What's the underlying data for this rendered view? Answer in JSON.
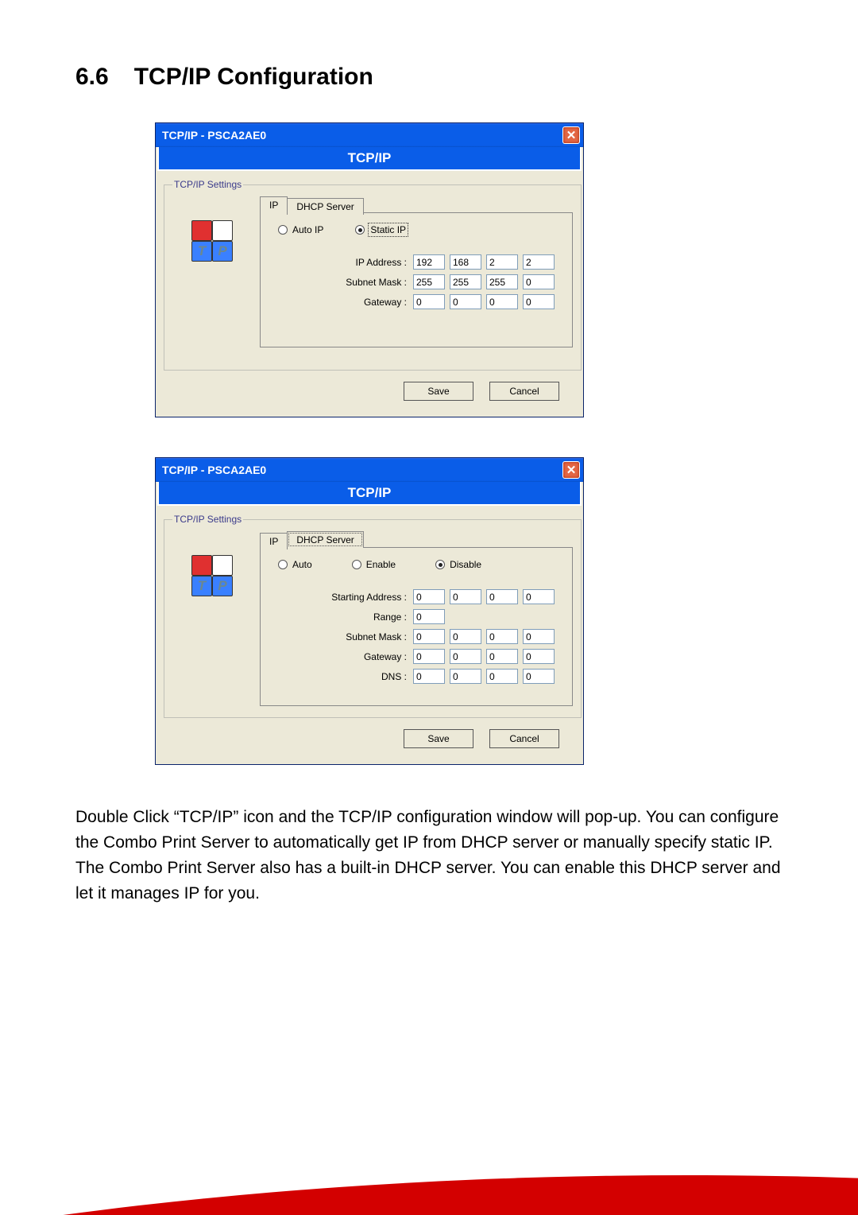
{
  "heading": {
    "number": "6.6",
    "title": "TCP/IP Configuration"
  },
  "dialog1": {
    "titlebar": "TCP/IP - PSCA2AE0",
    "banner": "TCP/IP",
    "groupLegend": "TCP/IP Settings",
    "tabs": {
      "ip": "IP",
      "dhcp": "DHCP Server",
      "active": "ip"
    },
    "radios": {
      "auto": "Auto IP",
      "static": "Static IP",
      "selected": "static"
    },
    "fields": {
      "ip_label": "IP Address :",
      "ip": [
        "192",
        "168",
        "2",
        "2"
      ],
      "mask_label": "Subnet Mask :",
      "mask": [
        "255",
        "255",
        "255",
        "0"
      ],
      "gw_label": "Gateway :",
      "gw": [
        "0",
        "0",
        "0",
        "0"
      ]
    },
    "buttons": {
      "save": "Save",
      "cancel": "Cancel"
    }
  },
  "dialog2": {
    "titlebar": "TCP/IP - PSCA2AE0",
    "banner": "TCP/IP",
    "groupLegend": "TCP/IP Settings",
    "tabs": {
      "ip": "IP",
      "dhcp": "DHCP Server",
      "active": "dhcp"
    },
    "radios": {
      "auto": "Auto",
      "enable": "Enable",
      "disable": "Disable",
      "selected": "disable"
    },
    "fields": {
      "start_label": "Starting Address :",
      "start": [
        "0",
        "0",
        "0",
        "0"
      ],
      "range_label": "Range :",
      "range": [
        "0"
      ],
      "mask_label": "Subnet Mask :",
      "mask": [
        "0",
        "0",
        "0",
        "0"
      ],
      "gw_label": "Gateway :",
      "gw": [
        "0",
        "0",
        "0",
        "0"
      ],
      "dns_label": "DNS :",
      "dns": [
        "0",
        "0",
        "0",
        "0"
      ]
    },
    "buttons": {
      "save": "Save",
      "cancel": "Cancel"
    }
  },
  "bodytext": "Double Click “TCP/IP” icon and the TCP/IP configuration window will pop-up.\nYou can configure the Combo Print Server to automatically get IP from DHCP server or manually specify static IP. The Combo Print Server also has a built-in DHCP server. You can enable this DHCP server and let it manages IP for you.",
  "icons": {
    "close": "✕",
    "t": "T",
    "p": "P"
  }
}
